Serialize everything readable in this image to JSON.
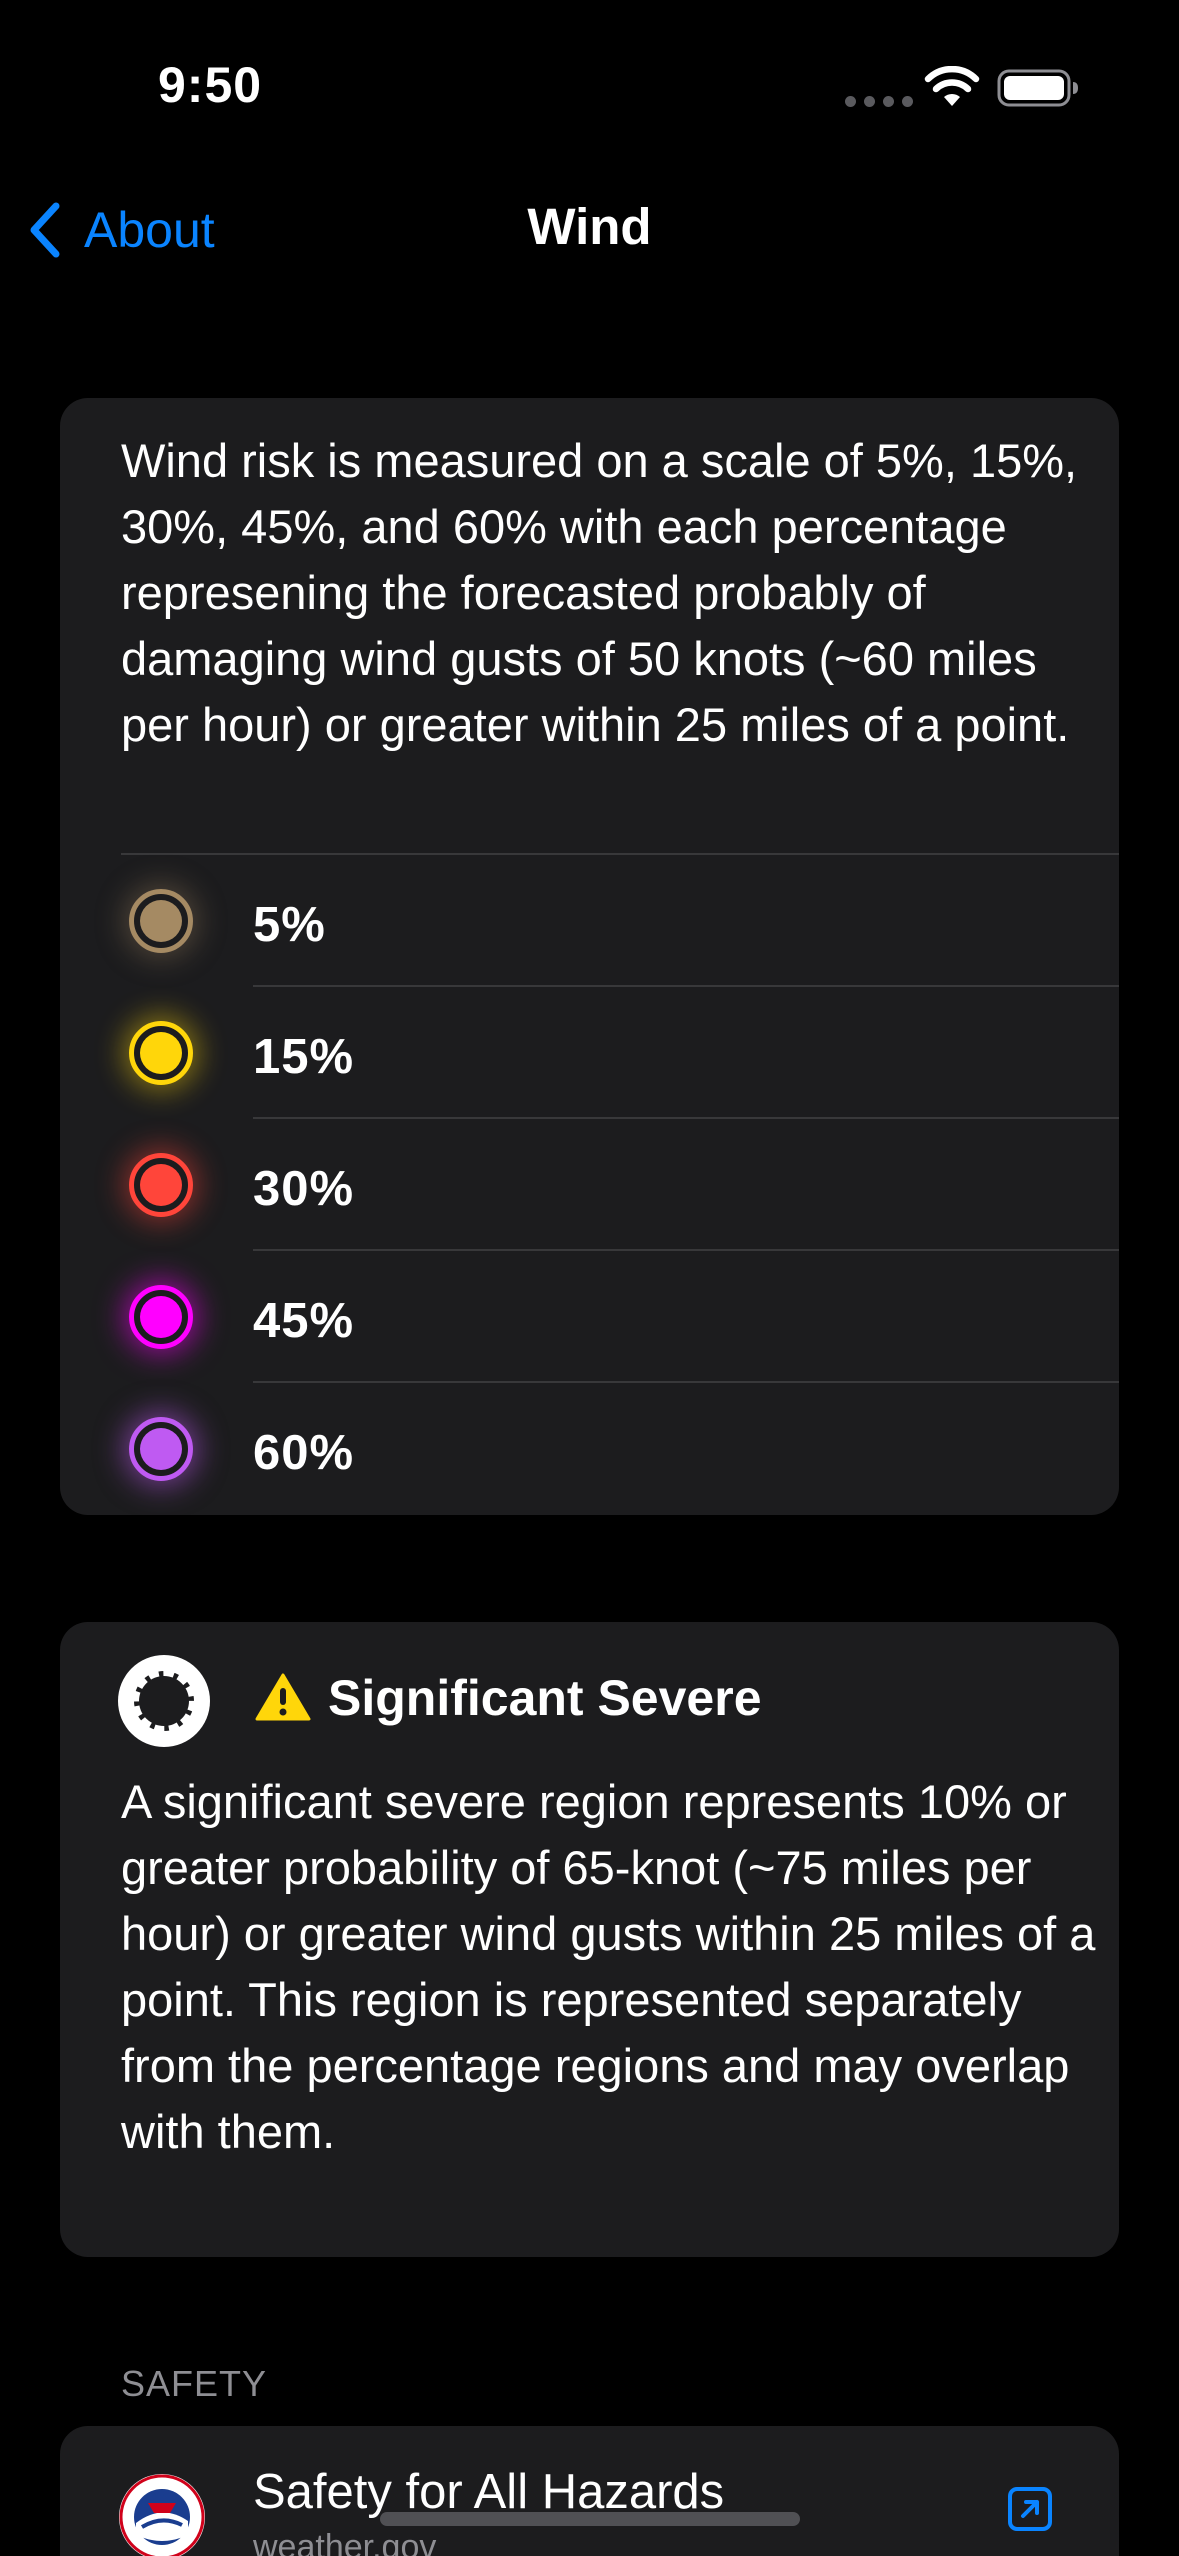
{
  "status_bar": {
    "time": "9:50"
  },
  "nav": {
    "back_label": "About",
    "title": "Wind"
  },
  "wind_card": {
    "intro": "Wind risk is measured on a scale of 5%, 15%, 30%, 45%, and 60% with each percentage represening the forecasted probably of damaging wind gusts of 50 knots (~60 miles per hour) or greater within 25 miles of a point.",
    "levels": [
      {
        "label": "5%",
        "color": "#a58a63",
        "glow": "rgba(165,138,99,0.35)"
      },
      {
        "label": "15%",
        "color": "#ffd60a",
        "glow": "rgba(255,214,10,0.45)"
      },
      {
        "label": "30%",
        "color": "#ff453a",
        "glow": "rgba(255,69,58,0.45)"
      },
      {
        "label": "45%",
        "color": "#ff00ff",
        "glow": "rgba(255,0,255,0.5)"
      },
      {
        "label": "60%",
        "color": "#bf5af2",
        "glow": "rgba(191,90,242,0.5)"
      }
    ]
  },
  "significant_card": {
    "title": "Significant Severe",
    "description": "A significant severe region represents 10% or greater probability of 65-knot (~75 miles per hour) or greater wind gusts within 25 miles of a point. This region is represented separately from the percentage regions and may overlap with them.",
    "warning_color": "#ffd60a"
  },
  "safety_section": {
    "header": "SAFETY",
    "items": [
      {
        "title": "Safety for All Hazards",
        "subtitle": "weather.gov"
      }
    ]
  },
  "colors": {
    "accent": "#0a84ff",
    "card_background": "#1c1c1e",
    "background": "#000000",
    "secondary_text": "#8e8e93"
  }
}
